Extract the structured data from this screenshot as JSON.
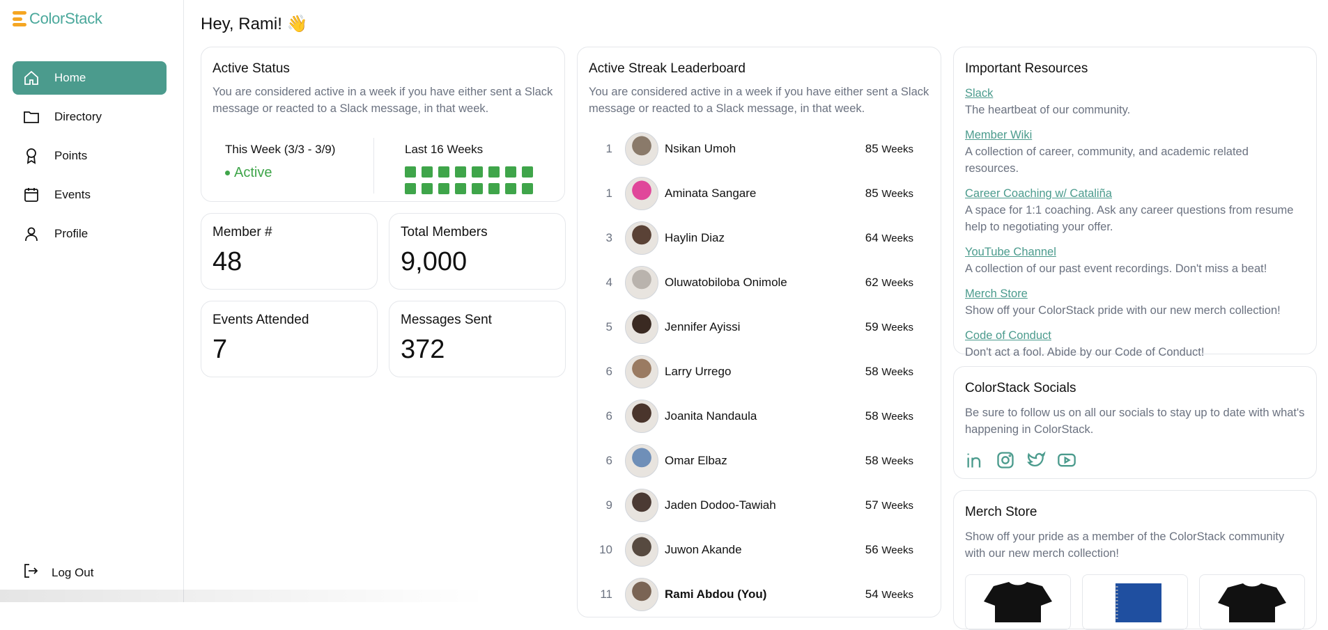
{
  "app": {
    "brand": "ColorStack",
    "brand_color": "#4aa89b",
    "accent_color": "#4b9b8d",
    "active_color": "#3fa54a"
  },
  "sidebar": {
    "items": [
      {
        "label": "Home",
        "icon": "home-icon",
        "active": true
      },
      {
        "label": "Directory",
        "icon": "folder-icon",
        "active": false
      },
      {
        "label": "Points",
        "icon": "award-icon",
        "active": false
      },
      {
        "label": "Events",
        "icon": "calendar-icon",
        "active": false
      },
      {
        "label": "Profile",
        "icon": "user-icon",
        "active": false
      }
    ],
    "logout": "Log Out"
  },
  "greeting": "Hey, Rami! 👋",
  "active_status": {
    "title": "Active Status",
    "description": "You are considered active in a week if you have either sent a Slack message or reacted to a Slack message, in that week.",
    "this_week_label": "This Week (3/3 - 3/9)",
    "state": "Active",
    "last_weeks_label": "Last 16 Weeks",
    "weeks_active": 16
  },
  "stats": {
    "member_number": {
      "label": "Member #",
      "value": "48"
    },
    "total_members": {
      "label": "Total Members",
      "value": "9,000"
    },
    "events_attended": {
      "label": "Events Attended",
      "value": "7"
    },
    "messages_sent": {
      "label": "Messages Sent",
      "value": "372"
    }
  },
  "leaderboard": {
    "title": "Active Streak Leaderboard",
    "description": "You are considered active in a week if you have either sent a Slack message or reacted to a Slack message, in that week.",
    "unit": "Weeks",
    "rows": [
      {
        "rank": "1",
        "name": "Nsikan Umoh",
        "weeks": "85",
        "avatar_color": "#8a7a6a"
      },
      {
        "rank": "1",
        "name": "Aminata Sangare",
        "weeks": "85",
        "avatar_color": "#e0479a"
      },
      {
        "rank": "3",
        "name": "Haylin Diaz",
        "weeks": "64",
        "avatar_color": "#5a4236"
      },
      {
        "rank": "4",
        "name": "Oluwatobiloba Onimole",
        "weeks": "62",
        "avatar_color": "#b9b3ad"
      },
      {
        "rank": "5",
        "name": "Jennifer Ayissi",
        "weeks": "59",
        "avatar_color": "#3a2a22"
      },
      {
        "rank": "6",
        "name": "Larry Urrego",
        "weeks": "58",
        "avatar_color": "#9a7b62"
      },
      {
        "rank": "6",
        "name": "Joanita Nandaula",
        "weeks": "58",
        "avatar_color": "#4a352c"
      },
      {
        "rank": "6",
        "name": "Omar Elbaz",
        "weeks": "58",
        "avatar_color": "#6f8fb8"
      },
      {
        "rank": "9",
        "name": "Jaden Dodoo-Tawiah",
        "weeks": "57",
        "avatar_color": "#4b3a33"
      },
      {
        "rank": "10",
        "name": "Juwon Akande",
        "weeks": "56",
        "avatar_color": "#574a40"
      },
      {
        "rank": "11",
        "name": "Rami Abdou (You)",
        "weeks": "54",
        "avatar_color": "#7a6454",
        "me": true
      }
    ]
  },
  "resources": {
    "title": "Important Resources",
    "items": [
      {
        "link": "Slack",
        "description": "The heartbeat of our community."
      },
      {
        "link": "Member Wiki",
        "description": "A collection of career, community, and academic related resources."
      },
      {
        "link": "Career Coaching w/ Cataliña",
        "description": "A space for 1:1 coaching. Ask any career questions from resume help to negotiating your offer."
      },
      {
        "link": "YouTube Channel",
        "description": "A collection of our past event recordings. Don't miss a beat!"
      },
      {
        "link": "Merch Store",
        "description": "Show off your ColorStack pride with our new merch collection!"
      },
      {
        "link": "Code of Conduct",
        "description": "Don't act a fool. Abide by our Code of Conduct!"
      }
    ]
  },
  "socials": {
    "title": "ColorStack Socials",
    "description": "Be sure to follow us on all our socials to stay up to date with what's happening in ColorStack.",
    "icons": [
      "linkedin-icon",
      "instagram-icon",
      "twitter-icon",
      "youtube-icon"
    ]
  },
  "merch": {
    "title": "Merch Store",
    "description": "Show off your pride as a member of the ColorStack community with our new merch collection!",
    "items": [
      "black t-shirt",
      "blue notebook",
      "black t-shirt"
    ]
  }
}
